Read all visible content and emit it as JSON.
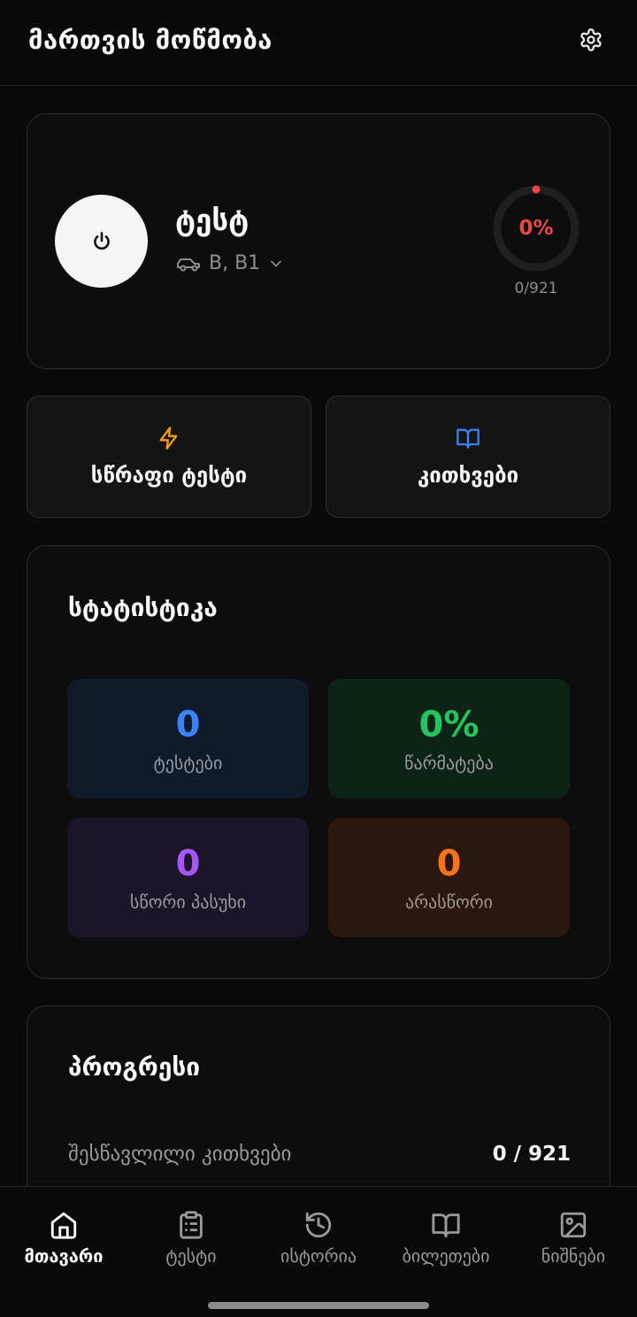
{
  "header": {
    "title": "მართვის მოწმობა",
    "settings_icon": "gear-icon"
  },
  "profile": {
    "avatar_icon": "power-icon",
    "name": "ტესტ",
    "category_icon": "car-icon",
    "category": "B, B1",
    "progress_percent": 0,
    "progress_label": "0%",
    "progress_count": "0/921",
    "accent_color": "#ef4444"
  },
  "actions": [
    {
      "label": "სწრაფი ტესტი",
      "icon": "lightning-icon",
      "color": "#f59e0b"
    },
    {
      "label": "კითხვები",
      "icon": "book-open-icon",
      "color": "#3b82f6"
    }
  ],
  "stats": {
    "title": "სტატისტიკა",
    "tiles": [
      {
        "value": "0",
        "caption": "ტესტები",
        "color": "#3b82f6"
      },
      {
        "value": "0%",
        "caption": "წარმატება",
        "color": "#22c55e"
      },
      {
        "value": "0",
        "caption": "სწორი პასუხი",
        "color": "#a855f7"
      },
      {
        "value": "0",
        "caption": "არასწორი",
        "color": "#f97316"
      }
    ]
  },
  "progress": {
    "title": "პროგრესი",
    "rows": [
      {
        "label": "შესწავლილი კითხვები",
        "value": "0 / 921"
      }
    ]
  },
  "nav": {
    "active": 0,
    "items": [
      {
        "label": "მთავარი",
        "icon": "home-icon"
      },
      {
        "label": "ტესტი",
        "icon": "clipboard-list-icon"
      },
      {
        "label": "ისტორია",
        "icon": "history-icon"
      },
      {
        "label": "ბილეთები",
        "icon": "book-open-icon"
      },
      {
        "label": "ნიშნები",
        "icon": "image-icon"
      }
    ]
  }
}
